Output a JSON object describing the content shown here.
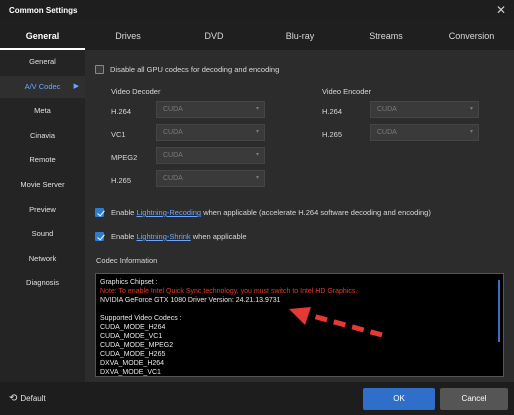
{
  "window": {
    "title": "Common Settings"
  },
  "tabs": [
    {
      "label": "General"
    },
    {
      "label": "Drives"
    },
    {
      "label": "DVD"
    },
    {
      "label": "Blu-ray"
    },
    {
      "label": "Streams"
    },
    {
      "label": "Conversion"
    }
  ],
  "sidebar": {
    "items": [
      {
        "label": "General"
      },
      {
        "label": "A/V Codec"
      },
      {
        "label": "Meta"
      },
      {
        "label": "Cinavia"
      },
      {
        "label": "Remote"
      },
      {
        "label": "Movie Server"
      },
      {
        "label": "Preview"
      },
      {
        "label": "Sound"
      },
      {
        "label": "Network"
      },
      {
        "label": "Diagnosis"
      }
    ],
    "active": "A/V Codec"
  },
  "main": {
    "disable_all_label": "Disable all GPU codecs for decoding and encoding",
    "decoder": {
      "title": "Video Decoder",
      "rows": [
        {
          "label": "H.264",
          "value": "CUDA"
        },
        {
          "label": "VC1",
          "value": "CUDA"
        },
        {
          "label": "MPEG2",
          "value": "CUDA"
        },
        {
          "label": "H.265",
          "value": "CUDA"
        }
      ]
    },
    "encoder": {
      "title": "Video Encoder",
      "rows": [
        {
          "label": "H.264",
          "value": "CUDA"
        },
        {
          "label": "H.265",
          "value": "CUDA"
        }
      ]
    },
    "recoding": {
      "pre": "Enable",
      "link": "Lightning-Recoding",
      "post": "when applicable (accelerate H.264 software decoding and encoding)"
    },
    "shrink": {
      "pre": "Enable",
      "link": "Lightning-Shrink",
      "post": "when applicable"
    },
    "codec_info_title": "Codec Information",
    "codec_lines": [
      "Graphics Chipset :",
      "Note: To enable Intel Quick Sync technology, you must switch to Intel HD Graphics.",
      "NVIDIA GeForce GTX 1080 Driver Version: 24.21.13.9731",
      "",
      "Supported Video Codecs :",
      "CUDA_MODE_H264",
      "CUDA_MODE_VC1",
      "CUDA_MODE_MPEG2",
      "CUDA_MODE_H265",
      "DXVA_MODE_H264",
      "DXVA_MODE_VC1"
    ]
  },
  "footer": {
    "default_label": "Default",
    "ok_label": "OK",
    "cancel_label": "Cancel"
  },
  "colors": {
    "accent": "#2f6fc9",
    "link": "#6ea6ff",
    "note_red": "#e23a2a",
    "annotation_arrow": "#e53935"
  }
}
